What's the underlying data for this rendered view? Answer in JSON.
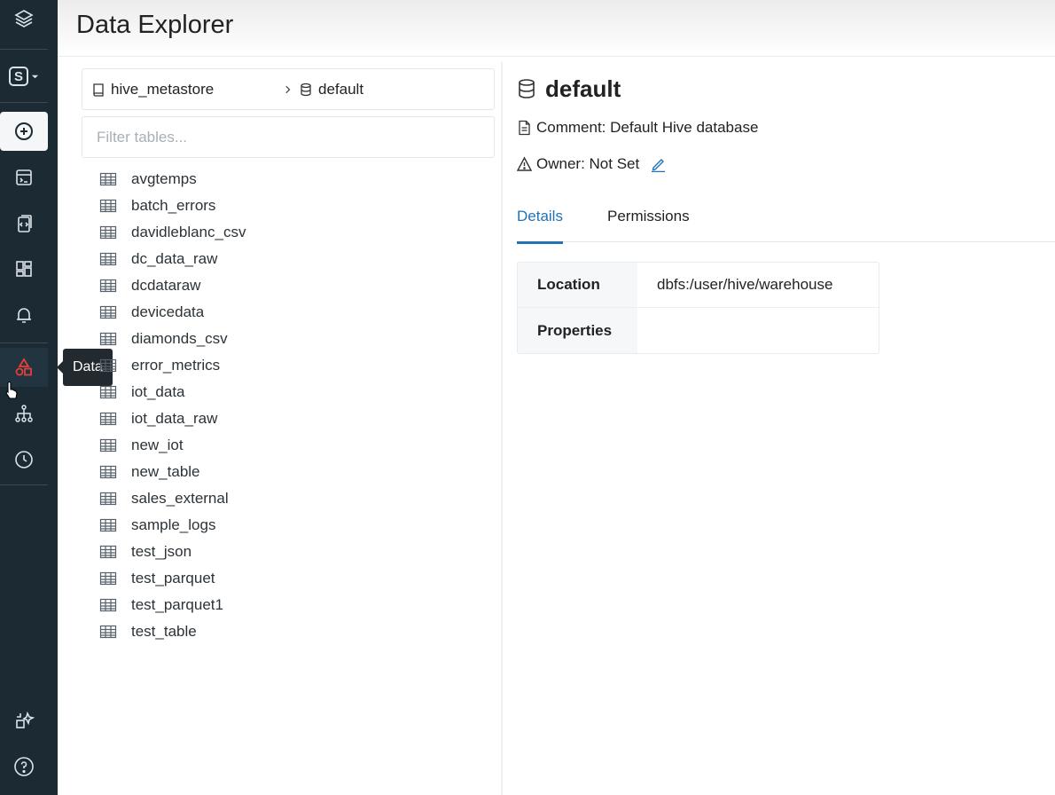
{
  "app": {
    "title": "Data Explorer"
  },
  "rail": {
    "workspace_letter": "S",
    "tooltip": "Data",
    "icons": [
      "databricks-logo-icon",
      "persona-switcher-icon",
      "create-icon",
      "sql-editor-icon",
      "queries-icon",
      "dashboards-icon",
      "alerts-icon",
      "data-icon",
      "lineage-icon",
      "history-icon",
      "partner-connect-icon",
      "help-icon"
    ]
  },
  "breadcrumb": {
    "catalog": "hive_metastore",
    "schema": "default"
  },
  "filter": {
    "placeholder": "Filter tables...",
    "value": ""
  },
  "tables": [
    "avgtemps",
    "batch_errors",
    "davidleblanc_csv",
    "dc_data_raw",
    "dcdataraw",
    "devicedata",
    "diamonds_csv",
    "error_metrics",
    "iot_data",
    "iot_data_raw",
    "new_iot",
    "new_table",
    "sales_external",
    "sample_logs",
    "test_json",
    "test_parquet",
    "test_parquet1",
    "test_table"
  ],
  "detail": {
    "name": "default",
    "comment": "Comment: Default Hive database",
    "owner": "Owner: Not Set",
    "tabs": [
      "Details",
      "Permissions"
    ],
    "active_tab": "Details",
    "rows": [
      {
        "key": "Location",
        "value": "dbfs:/user/hive/warehouse"
      },
      {
        "key": "Properties",
        "value": ""
      }
    ]
  },
  "colors": {
    "rail_bg": "#1b2a33",
    "accent": "#2272b4",
    "data_icon": "#e0413a"
  }
}
